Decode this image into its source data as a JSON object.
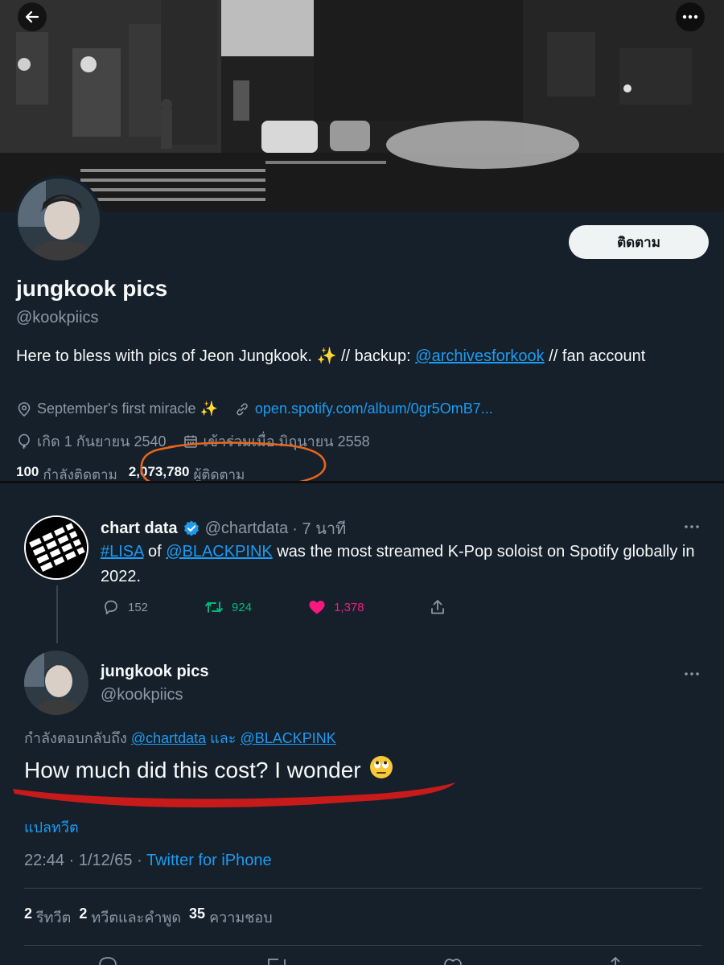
{
  "profile": {
    "follow_label": "ติดตาม",
    "name": "jungkook pics",
    "handle": "@kookpiics",
    "bio": {
      "text_before": "Here to bless with pics of Jeon Jungkook. ",
      "sparkles": "✨",
      "text_mid": " // backup: ",
      "mention": "@archivesforkook",
      "text_after": " // fan account"
    },
    "location": "September's first miracle ✨",
    "website": "open.spotify.com/album/0gr5OmB7...",
    "birthday": "เกิด 1 กันยายน 2540",
    "joined": "เข้าร่วมเมื่อ มิถุนายน 2558",
    "following_count": "100",
    "following_label": "กำลังติดตาม",
    "followers_count": "2,073,780",
    "followers_label": "ผู้ติดตาม"
  },
  "quoted_tweet": {
    "name": "chart data",
    "handle": "@chartdata",
    "time": "· 7 นาที",
    "hashtag": "#LISA",
    "text_mid": " of ",
    "mention": "@BLACKPINK",
    "text_after": " was the most streamed K-Pop soloist on Spotify globally in 2022.",
    "replies": "152",
    "retweets": "924",
    "likes": "1,378"
  },
  "reply_tweet": {
    "name": "jungkook pics",
    "handle": "@kookpiics",
    "replying_to_label": "กำลังตอบกลับถึง",
    "replying_to_1": "@chartdata",
    "replying_and": "และ",
    "replying_to_2": "@BLACKPINK",
    "text": "How much did this cost? I wonder",
    "emoji": "🙄",
    "translate_label": "แปลทวีต",
    "time": "22:44 · 1/12/65 · ",
    "source": "Twitter for iPhone",
    "retweet_count": "2",
    "retweet_label": "รีทวีต",
    "quote_count": "2",
    "quote_label": "ทวีตและคำพูด",
    "like_count": "35",
    "like_label": "ความชอบ"
  },
  "colors": {
    "background": "#15202b",
    "accent": "#1d9bf0",
    "retweet": "#00ba7c",
    "like": "#f91880",
    "annotation_orange": "#e8661c",
    "annotation_red": "#d11a1a"
  }
}
